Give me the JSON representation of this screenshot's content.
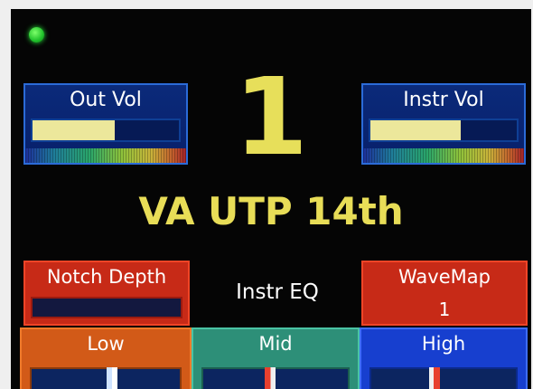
{
  "status": {
    "led_color": "#29e33a"
  },
  "out_vol": {
    "label": "Out Vol",
    "level": 0.56
  },
  "instr_vol": {
    "label": "Instr Vol",
    "level": 0.62
  },
  "preset": {
    "number": "1",
    "name": "VA UTP 14th"
  },
  "notch_depth": {
    "label": "Notch Depth",
    "level": 0
  },
  "instr_eq": {
    "label": "Instr EQ"
  },
  "wavemap": {
    "label": "WaveMap",
    "value": "1"
  },
  "eq": {
    "low": {
      "label": "Low",
      "position": 0.54
    },
    "mid": {
      "label": "Mid",
      "position": 0.46
    },
    "high": {
      "label": "High",
      "position": 0.44
    }
  },
  "colors": {
    "preset_text": "#e7df5a",
    "vol_panel": "#0b2a7a",
    "red_panel": "#c72a17",
    "low_panel": "#d25a18",
    "mid_panel": "#2d8f78",
    "high_panel": "#173fcf"
  }
}
